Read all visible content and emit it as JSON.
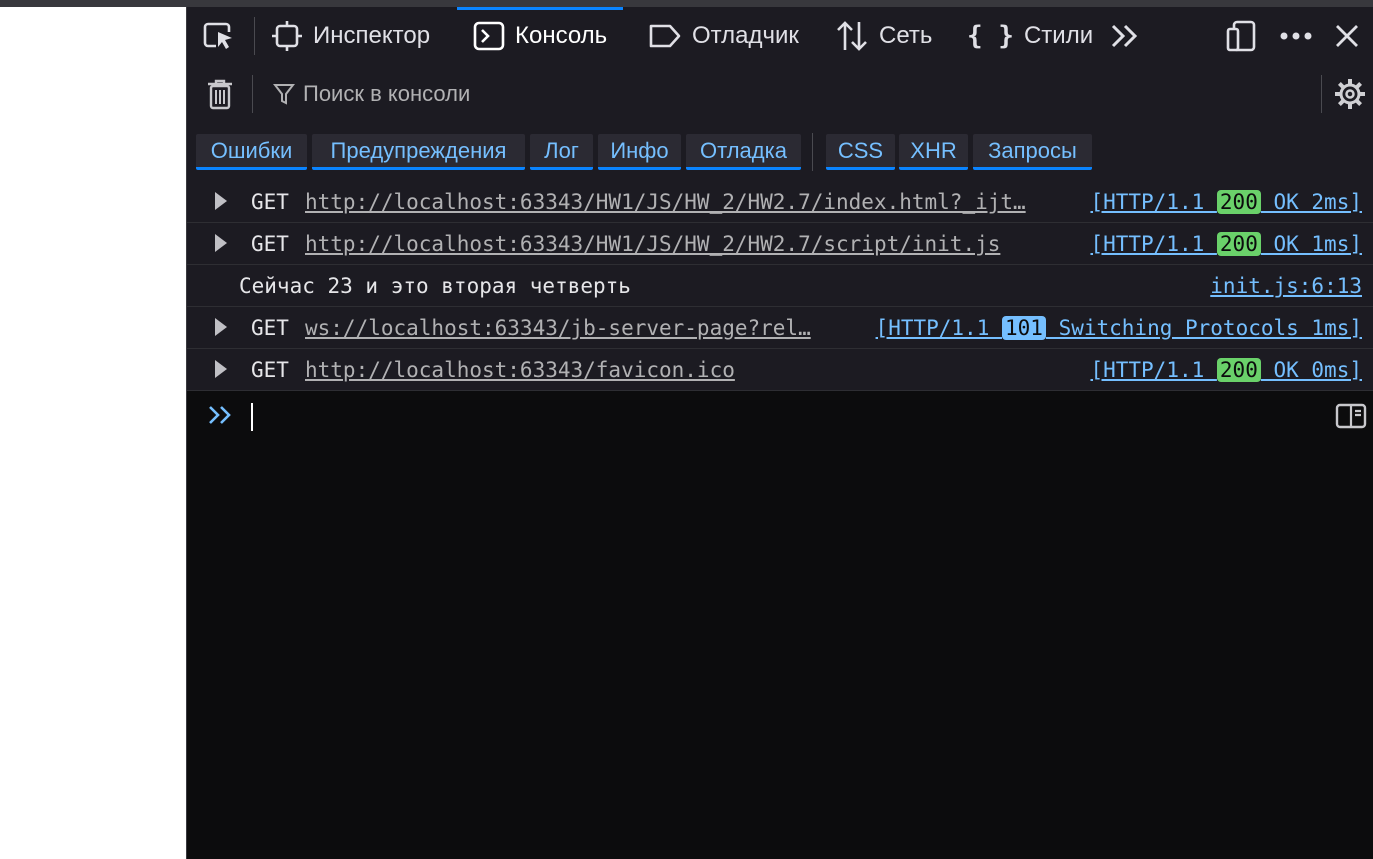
{
  "toolbar": {
    "tabs": [
      {
        "label": "Инспектор",
        "icon": "inspector-icon"
      },
      {
        "label": "Консоль",
        "icon": "console-icon",
        "active": true
      },
      {
        "label": "Отладчик",
        "icon": "debugger-icon"
      },
      {
        "label": "Сеть",
        "icon": "network-icon"
      },
      {
        "label": "Стили",
        "icon": "style-editor-icon"
      }
    ],
    "more_tabs_icon": "double-chevron-right-icon",
    "responsive_icon": "responsive-design-icon",
    "menu_icon": "more-options-icon",
    "close_icon": "close-icon"
  },
  "filter": {
    "placeholder": "Поиск в консоли"
  },
  "levels": [
    {
      "label": "Ошибки"
    },
    {
      "label": "Предупреждения"
    },
    {
      "label": "Лог"
    },
    {
      "label": "Инфо"
    },
    {
      "label": "Отладка"
    },
    {
      "label": "CSS"
    },
    {
      "label": "XHR"
    },
    {
      "label": "Запросы"
    }
  ],
  "messages": [
    {
      "type": "request",
      "method": "GET",
      "url": "http://localhost:63343/HW1/JS/HW_2/HW2.7/index.html?_ijt…",
      "status_prefix": "[HTTP/1.1 ",
      "code": "200",
      "status_suffix": " OK 2ms]"
    },
    {
      "type": "request",
      "method": "GET",
      "url": "http://localhost:63343/HW1/JS/HW_2/HW2.7/script/init.js",
      "status_prefix": "[HTTP/1.1 ",
      "code": "200",
      "status_suffix": " OK 1ms]"
    },
    {
      "type": "log",
      "text": "Сейчас 23 и это вторая четверть",
      "source": "init.js:6:13"
    },
    {
      "type": "request",
      "method": "GET",
      "url": "ws://localhost:63343/jb-server-page?rel…",
      "status_prefix": "[HTTP/1.1 ",
      "code": "101",
      "status_suffix": " Switching Protocols 1ms]"
    },
    {
      "type": "request",
      "method": "GET",
      "url": "http://localhost:63343/favicon.ico",
      "status_prefix": "[HTTP/1.1 ",
      "code": "200",
      "status_suffix": " OK 0ms]"
    }
  ],
  "colors": {
    "accent": "#0a84ff",
    "link": "#75bfff",
    "status_ok": "#6ad16a",
    "status_info": "#75bfff",
    "background": "#0c0c0d"
  }
}
